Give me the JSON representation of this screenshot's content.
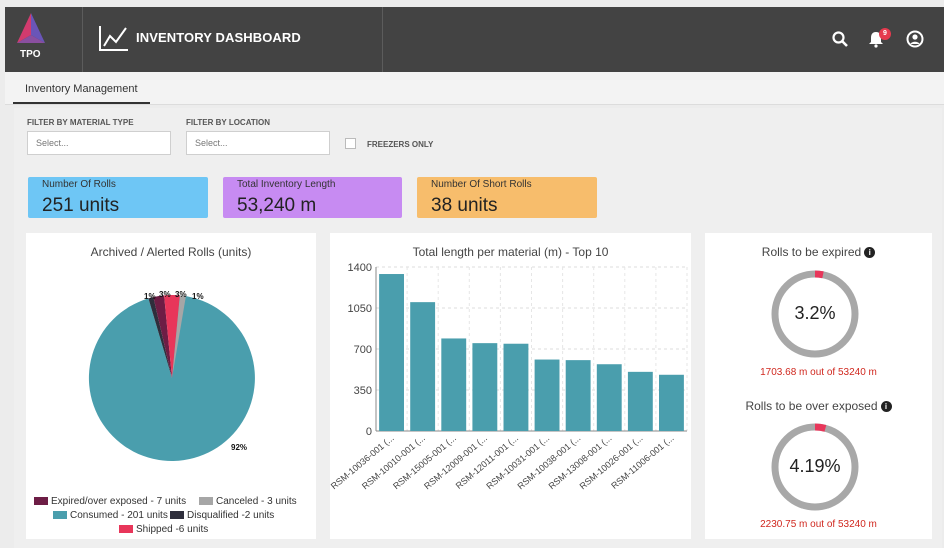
{
  "header": {
    "logo_text": "TPO",
    "title": "INVENTORY DASHBOARD",
    "notification_count": "9",
    "icons": [
      "search-icon",
      "bell-icon",
      "user-icon",
      "chart-line-icon"
    ]
  },
  "nav": {
    "tab_label": "Inventory Management"
  },
  "filters": {
    "material_label": "FILTER BY MATERIAL TYPE",
    "material_placeholder": "Select...",
    "location_label": "FILTER BY LOCATION",
    "location_placeholder": "Select...",
    "freezers_label": "FREEZERS ONLY"
  },
  "kpis": [
    {
      "label": "Number Of Rolls",
      "value": "251 units",
      "color": "#6ec6f5"
    },
    {
      "label": "Total Inventory Length",
      "value": "53,240 m",
      "color": "#c78bf2"
    },
    {
      "label": "Number Of Short Rolls",
      "value": "38 units",
      "color": "#f7bd6c"
    }
  ],
  "pie_card": {
    "title": "Archived / Alerted Rolls (units)",
    "slice_labels": [
      "1%",
      "3%",
      "3%",
      "1%",
      "92%"
    ],
    "legend": [
      {
        "label": "Expired/over exposed - 7 units",
        "color": "#6d1d45"
      },
      {
        "label": "Canceled - 3 units",
        "color": "#a6a6a6"
      },
      {
        "label": "Consumed - 201 units",
        "color": "#4a9ead"
      },
      {
        "label": "Disqualified -2 units",
        "color": "#2e2e3c"
      },
      {
        "label": "Shipped -6 units",
        "color": "#e8365a"
      }
    ]
  },
  "bar_card": {
    "title": "Total length per material (m) - Top 10"
  },
  "chart_data": {
    "type": "bar",
    "title": "Total length per material (m) - Top 10",
    "categories": [
      "RSM-10036-001 (...",
      "RSM-10010-001 (...",
      "RSM-15005-001 (...",
      "RSM-12009-001 (...",
      "RSM-12011-001 (...",
      "RSM-10031-001 (...",
      "RSM-10038-001 (...",
      "RSM-13008-001 (...",
      "RSM-10026-001 (...",
      "RSM-11006-001 (..."
    ],
    "values": [
      1340,
      1100,
      790,
      750,
      745,
      610,
      605,
      570,
      505,
      480
    ],
    "yticks": [
      "0",
      "350",
      "700",
      "1050",
      "1400"
    ],
    "ylim": [
      0,
      1400
    ],
    "color": "#4a9ead",
    "grid": true
  },
  "gauges": [
    {
      "title": "Rolls to be expired",
      "value_text": "3.2%",
      "value": 3.2,
      "sub": "1703.68 m out of 53240 m"
    },
    {
      "title": "Rolls to be over exposed",
      "value_text": "4.19%",
      "value": 4.19,
      "sub": "2230.75 m out of 53240 m"
    }
  ]
}
